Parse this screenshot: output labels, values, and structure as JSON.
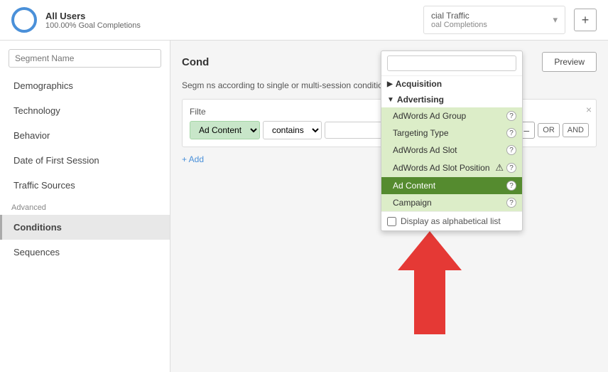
{
  "topBar": {
    "segment": {
      "title": "All Users",
      "subtitle": "100.00% Goal Completions"
    },
    "socialTraffic": {
      "title": "cial Traffic",
      "subtitle": "oal Completions"
    },
    "plusLabel": "+"
  },
  "sidebar": {
    "segmentNamePlaceholder": "Segment Name",
    "items": [
      {
        "label": "Demographics",
        "active": false
      },
      {
        "label": "Technology",
        "active": false
      },
      {
        "label": "Behavior",
        "active": false
      },
      {
        "label": "Date of First Session",
        "active": false
      },
      {
        "label": "Traffic Sources",
        "active": false
      }
    ],
    "advancedLabel": "Advanced",
    "advancedItems": [
      {
        "label": "Conditions",
        "active": true
      },
      {
        "label": "Sequences",
        "active": false
      }
    ]
  },
  "content": {
    "title": "Cond",
    "previewLabel": "Preview",
    "description": "Segm ns according to single or multi-session conditions.",
    "filterLabel": "Filte",
    "closeLabel": "×",
    "filterDimensionLabel": "Ad Content",
    "filterContainsLabel": "contains",
    "minusLabel": "–",
    "orLabel": "OR",
    "andLabel": "AND",
    "addFilterLabel": "+ Add"
  },
  "dropdown": {
    "searchPlaceholder": "",
    "sections": [
      {
        "label": "Acquisition",
        "collapsed": true,
        "arrow": "▶"
      },
      {
        "label": "Advertising",
        "collapsed": false,
        "arrow": "▼",
        "items": [
          {
            "label": "AdWords Ad Group",
            "selected": false
          },
          {
            "label": "Targeting Type",
            "selected": false
          },
          {
            "label": "AdWords Ad Slot",
            "selected": false
          },
          {
            "label": "AdWords Ad Slot Position",
            "selected": false,
            "warning": true
          },
          {
            "label": "Ad Content",
            "selected": true
          },
          {
            "label": "Campaign",
            "selected": false
          }
        ]
      }
    ],
    "footerCheckboxLabel": "Display as alphabetical list"
  }
}
